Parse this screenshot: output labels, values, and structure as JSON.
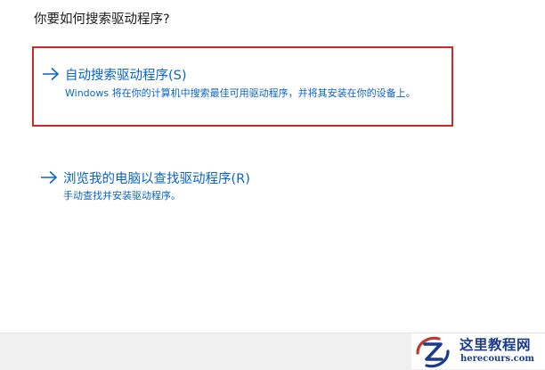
{
  "dialog": {
    "question": "你要如何搜索驱动程序?",
    "options": [
      {
        "title": "自动搜索驱动程序(S)",
        "description": "Windows 将在你的计算机中搜索最佳可用驱动程序，并将其安装在你的设备上。",
        "highlighted": true,
        "icon": "arrow-right-icon"
      },
      {
        "title": "浏览我的电脑以查找驱动程序(R)",
        "description": "手动查找并安装驱动程序。",
        "highlighted": false,
        "icon": "arrow-right-icon"
      }
    ]
  },
  "watermark": {
    "title": "这里教程网",
    "url": "herecours.com",
    "icon": "z-logo-icon"
  },
  "colors": {
    "link": "#0a64c4",
    "highlight_border": "#c72b2b",
    "text": "#1b1b1b",
    "footer": "#f0f0f0",
    "watermark": "#1a3c8c"
  }
}
